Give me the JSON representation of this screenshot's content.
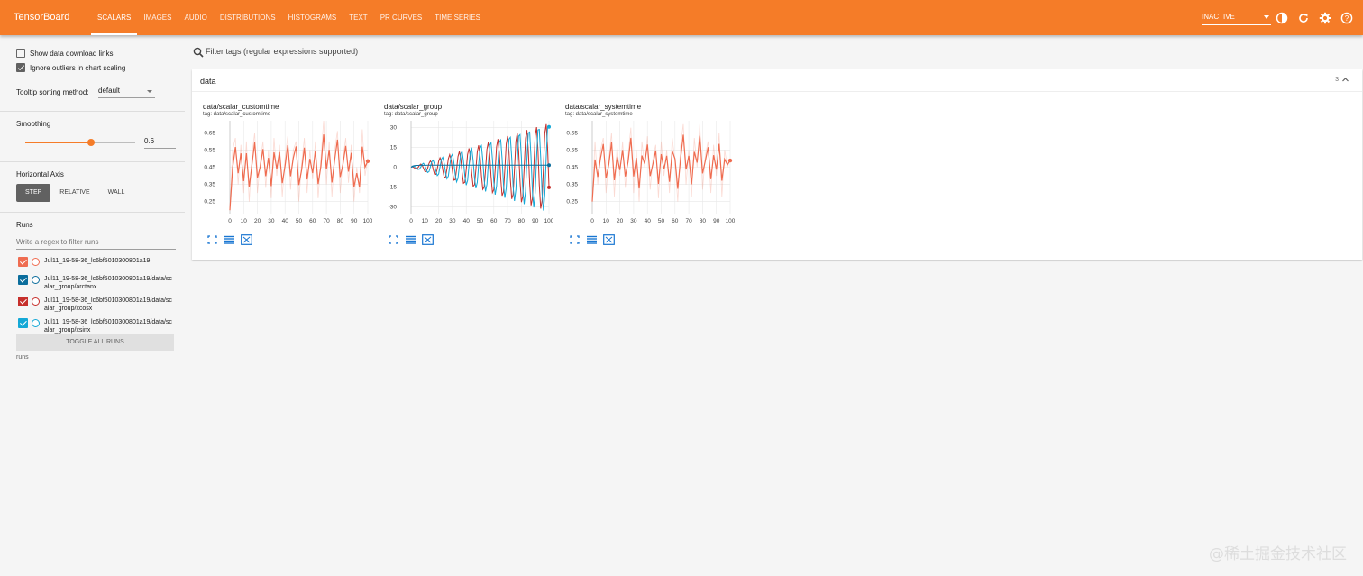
{
  "app": {
    "title": "TensorBoard"
  },
  "nav": {
    "tabs": [
      "SCALARS",
      "IMAGES",
      "AUDIO",
      "DISTRIBUTIONS",
      "HISTOGRAMS",
      "TEXT",
      "PR CURVES",
      "TIME SERIES"
    ],
    "active": 0
  },
  "toolbar": {
    "status": "INACTIVE",
    "icons": [
      "theme-icon",
      "reload-icon",
      "settings-icon",
      "help-icon"
    ]
  },
  "sidebar": {
    "show_download_links": {
      "label": "Show data download links",
      "checked": false
    },
    "ignore_outliers": {
      "label": "Ignore outliers in chart scaling",
      "checked": true
    },
    "tooltip_sorting": {
      "label": "Tooltip sorting method:",
      "value": "default"
    },
    "smoothing": {
      "label": "Smoothing",
      "value": "0.6",
      "level": 0.6
    },
    "horizontal_axis": {
      "label": "Horizontal Axis",
      "options": [
        "STEP",
        "RELATIVE",
        "WALL"
      ],
      "active": 0
    },
    "runs": {
      "label": "Runs",
      "filter_placeholder": "Write a regex to filter runs",
      "items": [
        {
          "name": "Jul11_19-58-36_lc6bf5010300801a19",
          "color": "#ef6c50",
          "checked": true
        },
        {
          "name": "Jul11_19-58-36_lc6bf5010300801a19/data/scalar_group/arctanx",
          "color": "#0b6d9c",
          "checked": true
        },
        {
          "name": "Jul11_19-58-36_lc6bf5010300801a19/data/scalar_group/xcosx",
          "color": "#c62f2b",
          "checked": true
        },
        {
          "name": "Jul11_19-58-36_lc6bf5010300801a19/data/scalar_group/xsinx",
          "color": "#14a8d6",
          "checked": true
        }
      ],
      "toggle_label": "TOGGLE ALL RUNS",
      "footer": "runs"
    }
  },
  "main": {
    "search_placeholder": "Filter tags (regular expressions supported)",
    "panel": {
      "title": "data",
      "count": "3",
      "cards": [
        {
          "title": "data/scalar_customtime",
          "tag": "tag: data/scalar_customtime"
        },
        {
          "title": "data/scalar_group",
          "tag": "tag: data/scalar_group"
        },
        {
          "title": "data/scalar_systemtime",
          "tag": "tag: data/scalar_systemtime"
        }
      ]
    }
  },
  "colors": {
    "brand": "#f57c28",
    "run_orange": "#ef6c50",
    "run_blue": "#0b6d9c",
    "run_red": "#c62f2b",
    "run_cyan": "#14a8d6"
  },
  "chart_data": [
    {
      "type": "line",
      "title": "data/scalar_customtime",
      "x_ticks": [
        "0",
        "10",
        "20",
        "30",
        "40",
        "50",
        "60",
        "70",
        "80",
        "90",
        "100"
      ],
      "y_ticks": [
        "0.65",
        "0.55",
        "0.45",
        "0.35",
        "0.25"
      ],
      "xlim": [
        0,
        100
      ],
      "ylim": [
        0.18,
        0.72
      ],
      "series": [
        {
          "color": "#ef6c50",
          "x": [
            0,
            2,
            4,
            6,
            8,
            10,
            12,
            14,
            16,
            18,
            20,
            22,
            24,
            26,
            28,
            30,
            32,
            34,
            36,
            38,
            40,
            42,
            44,
            46,
            48,
            50,
            52,
            54,
            56,
            58,
            60,
            62,
            64,
            66,
            68,
            70,
            72,
            74,
            76,
            78,
            80,
            82,
            84,
            86,
            88,
            90,
            92,
            94,
            96,
            98,
            100
          ],
          "y": [
            0.2,
            0.55,
            0.62,
            0.35,
            0.58,
            0.3,
            0.6,
            0.25,
            0.52,
            0.65,
            0.3,
            0.48,
            0.6,
            0.33,
            0.55,
            0.27,
            0.62,
            0.4,
            0.58,
            0.28,
            0.5,
            0.63,
            0.32,
            0.55,
            0.6,
            0.25,
            0.47,
            0.62,
            0.3,
            0.55,
            0.38,
            0.6,
            0.27,
            0.5,
            0.72,
            0.35,
            0.6,
            0.28,
            0.55,
            0.66,
            0.3,
            0.5,
            0.62,
            0.36,
            0.58,
            0.25,
            0.45,
            0.3,
            0.67,
            0.4,
            0.5
          ]
        }
      ]
    },
    {
      "type": "line",
      "title": "data/scalar_group",
      "x_ticks": [
        "0",
        "10",
        "20",
        "30",
        "40",
        "50",
        "60",
        "70",
        "80",
        "90",
        "100"
      ],
      "y_ticks": [
        "30",
        "15",
        "0",
        "-15",
        "-30"
      ],
      "xlim": [
        0,
        100
      ],
      "ylim": [
        -35,
        35
      ],
      "series": [
        {
          "color": "#c62f2b",
          "kind": "xcosx"
        },
        {
          "color": "#14a8d6",
          "kind": "xsinx"
        },
        {
          "color": "#0b6d9c",
          "kind": "arctanx"
        }
      ]
    },
    {
      "type": "line",
      "title": "data/scalar_systemtime",
      "x_ticks": [
        "0",
        "10",
        "20",
        "30",
        "40",
        "50",
        "60",
        "70",
        "80",
        "90",
        "100"
      ],
      "y_ticks": [
        "0.65",
        "0.55",
        "0.45",
        "0.35",
        "0.25"
      ],
      "xlim": [
        0,
        100
      ],
      "ylim": [
        0.18,
        0.72
      ],
      "series": [
        {
          "color": "#ef6c50",
          "x": [
            0,
            2,
            4,
            6,
            8,
            10,
            12,
            14,
            16,
            18,
            20,
            22,
            24,
            26,
            28,
            30,
            32,
            34,
            36,
            38,
            40,
            42,
            44,
            46,
            48,
            50,
            52,
            54,
            56,
            58,
            60,
            62,
            64,
            66,
            68,
            70,
            72,
            74,
            76,
            78,
            80,
            82,
            84,
            86,
            88,
            90,
            92,
            94,
            96,
            98,
            100
          ],
          "y": [
            0.25,
            0.6,
            0.35,
            0.55,
            0.62,
            0.3,
            0.5,
            0.65,
            0.28,
            0.57,
            0.4,
            0.6,
            0.33,
            0.52,
            0.68,
            0.3,
            0.55,
            0.25,
            0.6,
            0.45,
            0.63,
            0.32,
            0.5,
            0.58,
            0.27,
            0.6,
            0.4,
            0.55,
            0.3,
            0.62,
            0.48,
            0.25,
            0.57,
            0.7,
            0.35,
            0.55,
            0.28,
            0.62,
            0.45,
            0.7,
            0.32,
            0.52,
            0.6,
            0.3,
            0.58,
            0.4,
            0.65,
            0.28,
            0.55,
            0.45,
            0.5
          ]
        }
      ]
    }
  ],
  "watermark": "@稀土掘金技术社区"
}
